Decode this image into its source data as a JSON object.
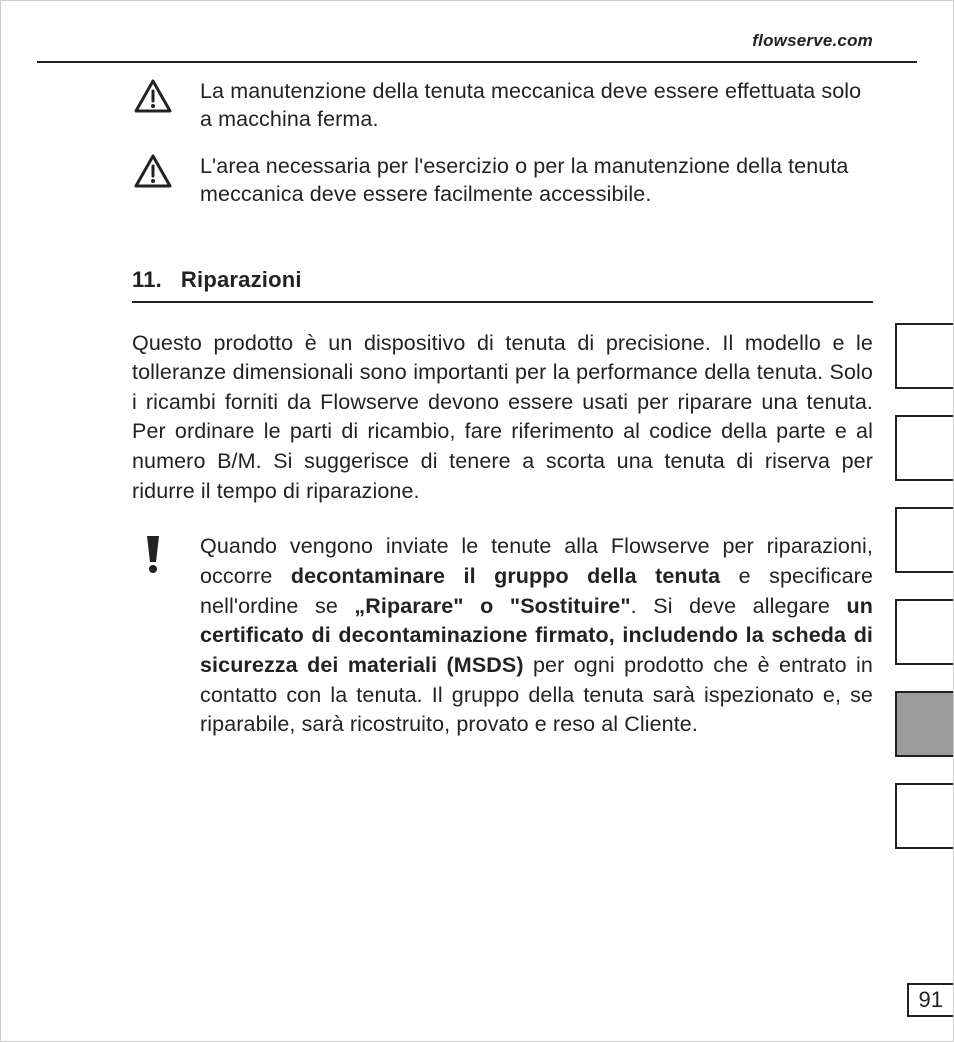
{
  "header": {
    "url": "flowserve.com"
  },
  "notes": [
    {
      "icon": "warning-triangle-icon",
      "text": "La manutenzione della tenuta meccanica deve essere effettuata solo a macchina ferma."
    },
    {
      "icon": "warning-triangle-icon",
      "text": "L'area necessaria per l'esercizio o per la manutenzione della tenuta meccanica deve essere facilmente accessibile."
    }
  ],
  "section": {
    "number": "11.",
    "title": "Riparazioni",
    "body": "Questo prodotto è un dispositivo di tenuta di precisione. Il modello e le tolleranze dimensionali sono importanti per la performance della tenuta. Solo i ricambi forniti da Flowserve devono essere usati per riparare una tenuta. Per ordinare le parti di ricambio, fare riferimento al codice della parte e al numero B/M. Si suggerisce di tenere a scorta una tenuta di riserva per ridurre il tempo di riparazione.",
    "important_note": {
      "icon": "important-exclaim-icon",
      "spans": [
        {
          "t": "Quando vengono inviate le tenute alla Flowserve per riparazioni, occorre ",
          "b": false
        },
        {
          "t": "decontaminare il gruppo della tenuta",
          "b": true
        },
        {
          "t": " e specificare nell'ordine se ",
          "b": false
        },
        {
          "t": "„Riparare\" o \"Sostituire\"",
          "b": true
        },
        {
          "t": ". Si deve allegare ",
          "b": false
        },
        {
          "t": "un certificato di decontaminazione firmato, includendo la scheda di sicurezza dei materiali (MSDS)",
          "b": true
        },
        {
          "t": " per ogni prodotto che è entrato in contatto con la tenuta. Il gruppo della tenuta sarà ispezionato e, se riparabile, sarà ricostruito, provato e reso al Cliente.",
          "b": false
        }
      ]
    }
  },
  "tabs": {
    "count": 6,
    "active_index": 4
  },
  "page_number": "91"
}
